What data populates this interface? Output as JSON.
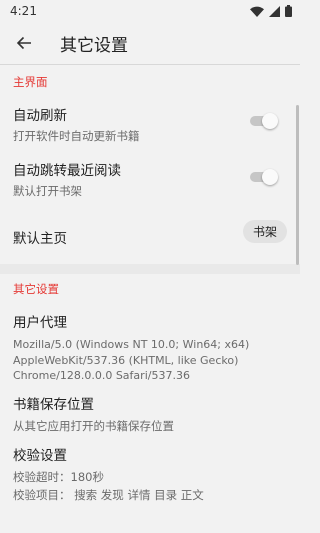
{
  "status_bar": {
    "time": "4:21"
  },
  "app_bar": {
    "title": "其它设置"
  },
  "sections": {
    "main": {
      "title": "主界面",
      "auto_refresh": {
        "title": "自动刷新",
        "summary": "打开软件时自动更新书籍",
        "enabled": false
      },
      "auto_jump": {
        "title": "自动跳转最近阅读",
        "summary": "默认打开书架",
        "enabled": false
      },
      "default_home": {
        "title": "默认主页",
        "value": "书架"
      }
    },
    "other": {
      "title": "其它设置",
      "user_agent": {
        "title": "用户代理",
        "summary": "Mozilla/5.0 (Windows NT 10.0; Win64; x64) AppleWebKit/537.36 (KHTML, like Gecko) Chrome/128.0.0.0 Safari/537.36"
      },
      "book_storage": {
        "title": "书籍保存位置",
        "summary": "从其它应用打开的书籍保存位置"
      },
      "check": {
        "title": "校验设置",
        "timeout": "校验超时：180秒",
        "items": "校验项目：  搜索 发现 详情 目录 正文"
      }
    }
  },
  "colors": {
    "accent": "#e53935",
    "background": "#f2f2f2",
    "chip_background": "#e2e2e2"
  }
}
